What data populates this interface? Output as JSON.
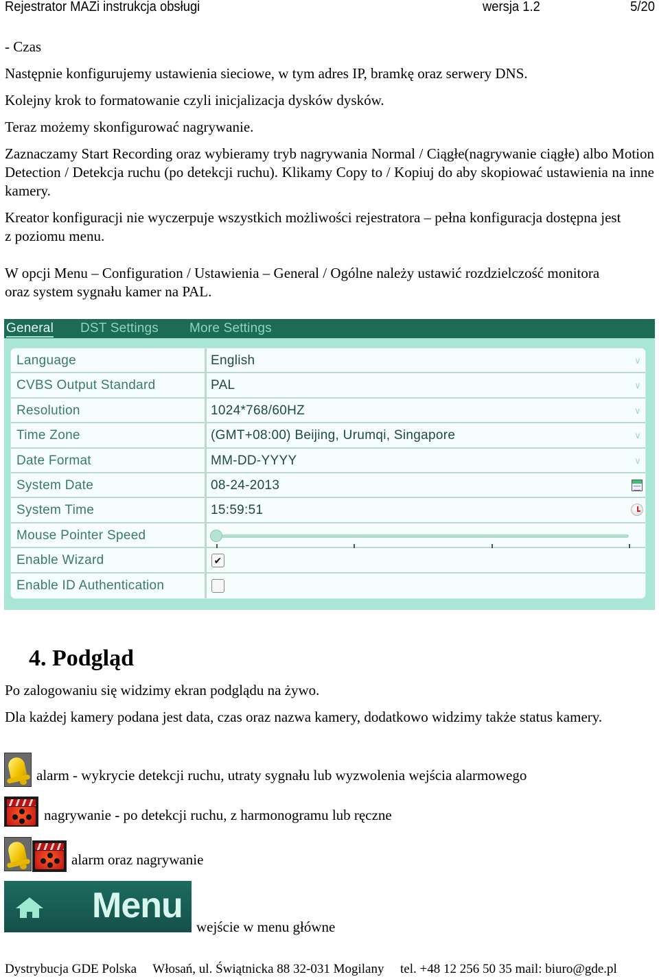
{
  "header": {
    "title": "Rejestrator MAZi instrukcja obsługi",
    "version": "wersja 1.2",
    "page": "5/20"
  },
  "body": {
    "paragraphs": [
      "- Czas",
      "Następnie konfigurujemy ustawienia sieciowe, w tym adres IP, bramkę oraz serwery DNS.",
      "Kolejny krok to formatowanie czyli inicjalizacja dysków dysków.",
      "Teraz możemy skonfigurować nagrywanie.",
      "Zaznaczamy Start Recording oraz wybieramy tryb nagrywania Normal / Ciągłe(nagrywanie ciągłe) albo Motion Detection / Detekcja ruchu (po detekcji ruchu). Klikamy Copy to / Kopiuj do aby skopiować ustawienia na inne kamery.",
      "Kreator konfiguracji nie wyczerpuje wszystkich możliwości rejestratora – pełna konfiguracja dostępna jest z poziomu menu.",
      "W opcji Menu – Configuration / Ustawienia – General / Ogólne należy ustawić rozdzielczość monitora oraz system sygnału kamer na PAL."
    ]
  },
  "settings_panel": {
    "colors": {
      "tab_bar": "#1d6b54",
      "panel_bg": "#a9e6d6",
      "label_text": "#3a7a68"
    },
    "tabs": [
      {
        "label": "General",
        "active": true
      },
      {
        "label": "DST Settings",
        "active": false
      },
      {
        "label": "More Settings",
        "active": false
      }
    ],
    "rows": [
      {
        "label": "Language",
        "value": "English",
        "control": "dropdown"
      },
      {
        "label": "CVBS Output Standard",
        "value": "PAL",
        "control": "dropdown"
      },
      {
        "label": "Resolution",
        "value": "1024*768/60HZ",
        "control": "dropdown"
      },
      {
        "label": "Time Zone",
        "value": "(GMT+08:00) Beijing, Urumqi, Singapore",
        "control": "dropdown"
      },
      {
        "label": "Date Format",
        "value": "MM-DD-YYYY",
        "control": "dropdown"
      },
      {
        "label": "System Date",
        "value": "08-24-2013",
        "control": "calendar"
      },
      {
        "label": "System Time",
        "value": "15:59:51",
        "control": "clock"
      },
      {
        "label": "Mouse Pointer Speed",
        "control": "slider",
        "slider_position": 0,
        "slider_steps": 4
      },
      {
        "label": "Enable Wizard",
        "control": "checkbox",
        "checked": true
      },
      {
        "label": "Enable ID Authentication",
        "control": "checkbox",
        "checked": false
      }
    ]
  },
  "section": {
    "heading": "4. Podgląd",
    "paragraphs": [
      "Po zalogowaniu się widzimy ekran podglądu na żywo.",
      "Dla każdej kamery podana jest data, czas oraz nazwa kamery, dodatkowo widzimy także status kamery."
    ],
    "legend": [
      {
        "icons": [
          "bell-icon"
        ],
        "text": "alarm - wykrycie detekcji ruchu, utraty sygnału lub wyzwolenia wejścia alarmowego"
      },
      {
        "icons": [
          "record-icon"
        ],
        "text": "nagrywanie - po detekcji ruchu, z harmonogramu lub ręczne"
      },
      {
        "icons": [
          "bell-icon",
          "record-icon"
        ],
        "text": "alarm oraz nagrywanie"
      }
    ],
    "menu_button": {
      "label": "Menu",
      "icon": "home-icon",
      "description": "wejście w menu główne"
    }
  },
  "footer": {
    "company": "Dystrybucja GDE Polska",
    "address": "Włosań, ul. Świątnicka 88 32-031 Mogilany",
    "contact": "tel. +48 12 256 50 35 mail: biuro@gde.pl"
  }
}
